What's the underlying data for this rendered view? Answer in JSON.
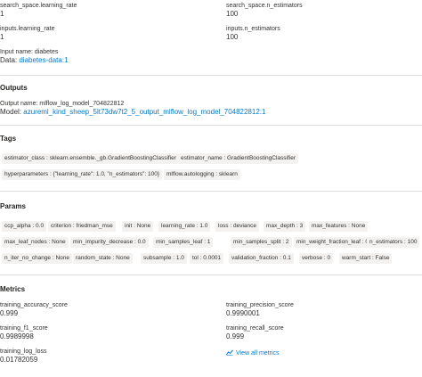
{
  "inputs": {
    "search_space_learning_rate": {
      "label": "search_space.learning_rate",
      "value": "1"
    },
    "search_space_n_estimators": {
      "label": "search_space.n_estimators",
      "value": "100"
    },
    "inputs_learning_rate": {
      "label": "inputs.learning_rate",
      "value": "1"
    },
    "inputs_n_estimators": {
      "label": "inputs.n_estimators",
      "value": "100"
    },
    "input_name": {
      "label": "Input name: diabetes"
    },
    "data": {
      "prefix": "Data:",
      "link": "diabetes-data:1"
    }
  },
  "outputs": {
    "title": "Outputs",
    "output_name": "Output name: mlflow_log_model_704822812",
    "model_prefix": "Model:",
    "model_link": "azureml_kind_sheep_5lt73dw7t2_5_output_mlflow_log_model_704822812:1"
  },
  "tags": {
    "title": "Tags",
    "items": [
      "estimator_class : sklearn.ensemble._gb.GradientBoostingClassifier",
      "estimator_name : GradientBoostingClassifier",
      "hyperparameters : {\"learning_rate\": 1.0, \"n_estimators\": 100}",
      "mlflow.autologging : sklearn"
    ]
  },
  "params": {
    "title": "Params",
    "items": [
      "ccp_alpha : 0.0",
      "criterion : friedman_mse",
      "init : None",
      "learning_rate : 1.0",
      "loss : deviance",
      "max_depth : 3",
      "max_features : None",
      "max_leaf_nodes : None",
      "min_impurity_decrease : 0.0",
      "min_samples_leaf : 1",
      "min_samples_split : 2",
      "min_weight_fraction_leaf : 0.0",
      "n_estimators : 100",
      "n_iter_no_change : None",
      "random_state : None",
      "subsample : 1.0",
      "tol : 0.0001",
      "validation_fraction : 0.1",
      "verbose : 0",
      "warm_start : False"
    ]
  },
  "metrics": {
    "title": "Metrics",
    "training_accuracy_score": {
      "label": "training_accuracy_score",
      "value": "0.999"
    },
    "training_precision_score": {
      "label": "training_precision_score",
      "value": "0.9990001"
    },
    "training_f1_score": {
      "label": "training_f1_score",
      "value": "0.9989998"
    },
    "training_recall_score": {
      "label": "training_recall_score",
      "value": "0.999"
    },
    "training_log_loss": {
      "label": "training_log_loss",
      "value": "0.01782059"
    },
    "view_all": "View all metrics",
    "view_all_icon": "chart-icon"
  },
  "colors": {
    "link": "#0078d4",
    "chip_bg": "#f3f2f1",
    "divider": "#e1dfdd"
  }
}
